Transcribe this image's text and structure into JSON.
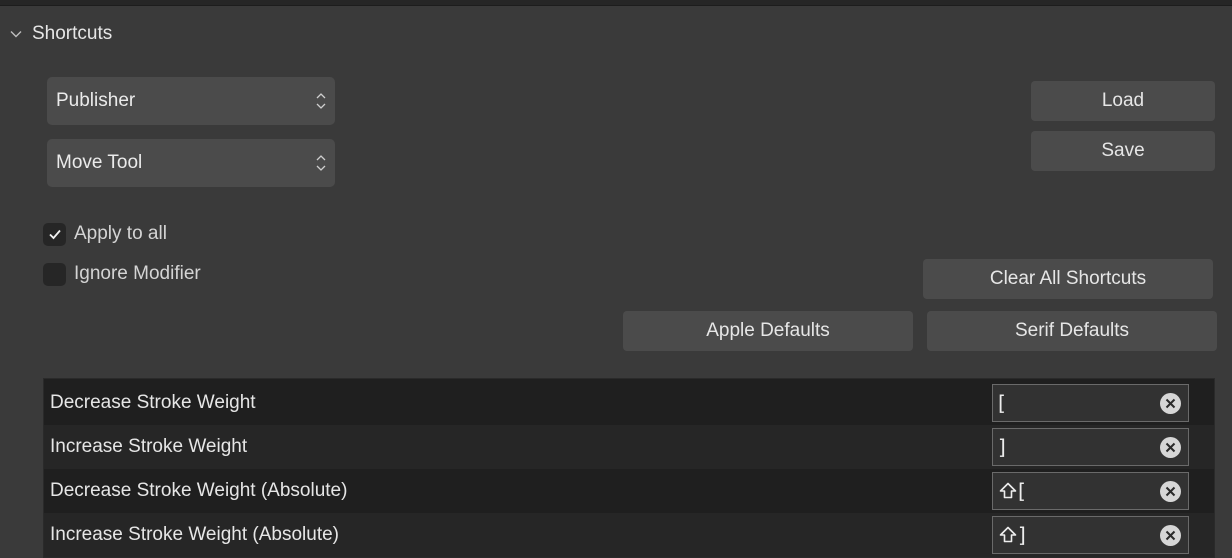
{
  "section": {
    "title": "Shortcuts",
    "expanded": true
  },
  "dropdowns": {
    "category": {
      "value": "Publisher"
    },
    "tool": {
      "value": "Move Tool"
    }
  },
  "buttons": {
    "load": "Load",
    "save": "Save",
    "clear_all": "Clear All Shortcuts",
    "apple_defaults": "Apple Defaults",
    "serif_defaults": "Serif Defaults"
  },
  "checkboxes": {
    "apply_to_all": {
      "label": "Apply to all",
      "checked": true
    },
    "ignore_modifier": {
      "label": "Ignore Modifier",
      "checked": false
    }
  },
  "shortcuts": [
    {
      "label": "Decrease Stroke Weight",
      "shift": false,
      "key": "["
    },
    {
      "label": "Increase Stroke Weight",
      "shift": false,
      "key": "]"
    },
    {
      "label": "Decrease Stroke Weight (Absolute)",
      "shift": true,
      "key": "["
    },
    {
      "label": "Increase Stroke Weight (Absolute)",
      "shift": true,
      "key": "]"
    }
  ],
  "icons": {
    "section_toggle": "chevron-down-icon",
    "dropdown_arrows": "up-down-arrows-icon",
    "checkmark": "checkmark-icon",
    "shift": "shift-icon",
    "clear": "clear-circle-icon"
  },
  "colors": {
    "panel_bg": "#3a3a3a",
    "control_bg": "#4b4b4b",
    "table_bg": "#1f1f1f",
    "text": "#e6e6e6"
  }
}
